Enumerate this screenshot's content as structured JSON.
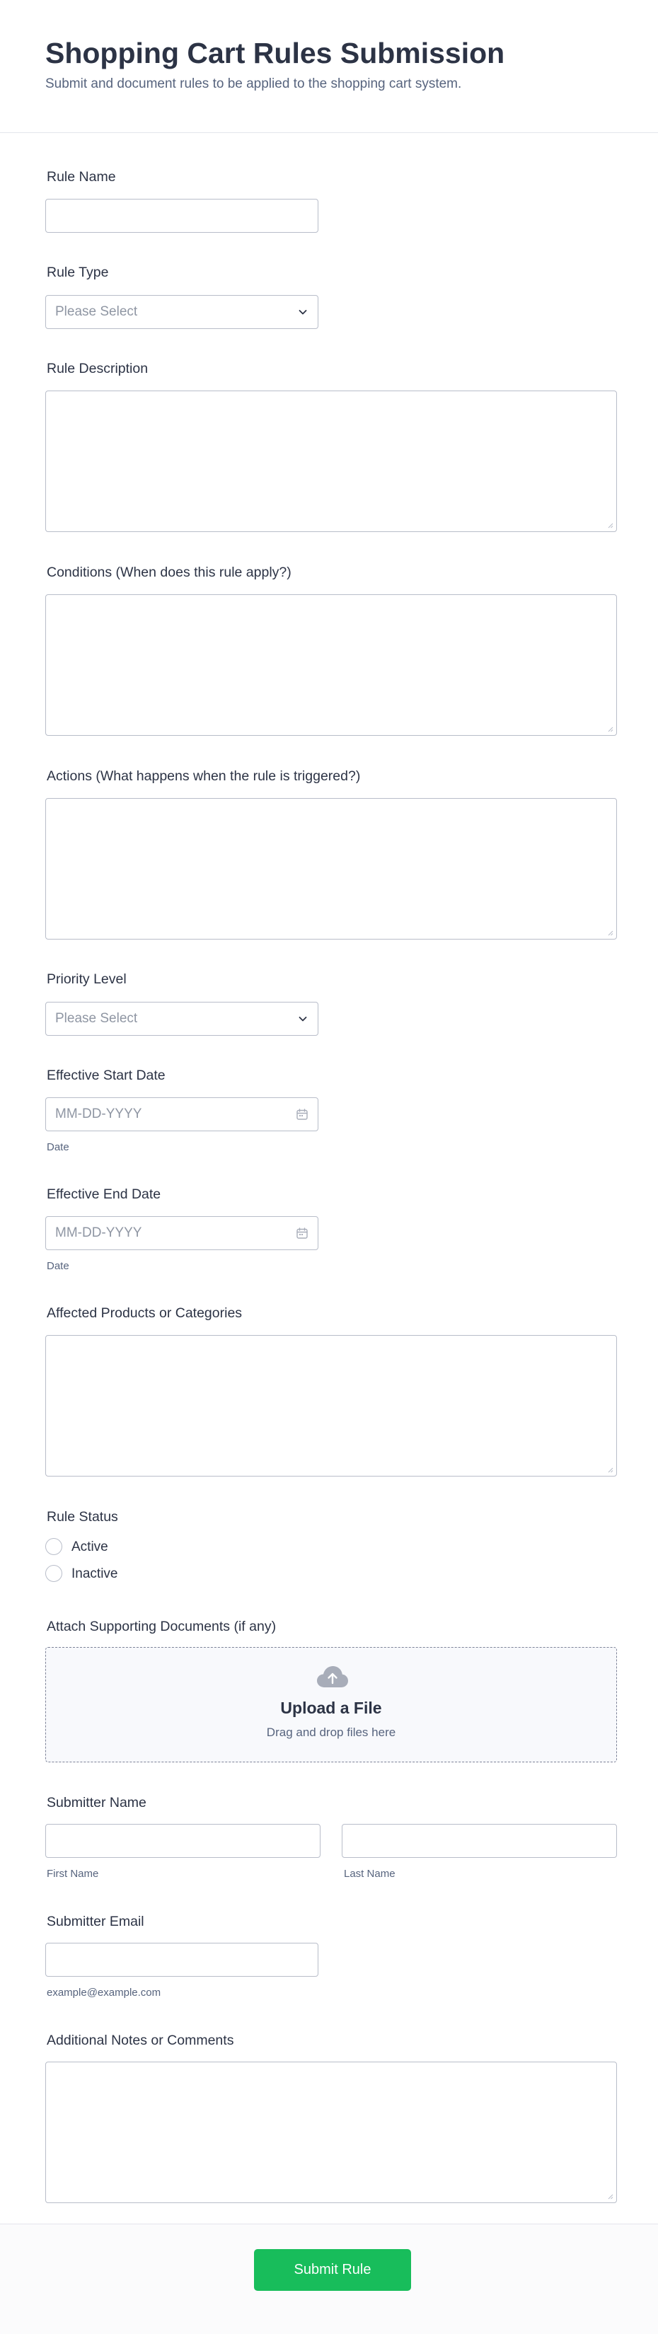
{
  "header": {
    "title": "Shopping Cart Rules Submission",
    "subtitle": "Submit and document rules to be applied to the shopping cart system."
  },
  "fields": {
    "rule_name": {
      "label": "Rule Name",
      "value": ""
    },
    "rule_type": {
      "label": "Rule Type",
      "placeholder": "Please Select"
    },
    "rule_description": {
      "label": "Rule Description",
      "value": ""
    },
    "conditions": {
      "label": "Conditions (When does this rule apply?)",
      "value": ""
    },
    "actions": {
      "label": "Actions (What happens when the rule is triggered?)",
      "value": ""
    },
    "priority_level": {
      "label": "Priority Level",
      "placeholder": "Please Select"
    },
    "start_date": {
      "label": "Effective Start Date",
      "placeholder": "MM-DD-YYYY",
      "sublabel": "Date"
    },
    "end_date": {
      "label": "Effective End Date",
      "placeholder": "MM-DD-YYYY",
      "sublabel": "Date"
    },
    "affected_products": {
      "label": "Affected Products or Categories",
      "value": ""
    },
    "rule_status": {
      "label": "Rule Status",
      "options": [
        "Active",
        "Inactive"
      ]
    },
    "attachments": {
      "label": "Attach Supporting Documents (if any)",
      "upload_title": "Upload a File",
      "upload_hint": "Drag and drop files here"
    },
    "submitter_name": {
      "label": "Submitter Name",
      "first_sublabel": "First Name",
      "last_sublabel": "Last Name"
    },
    "submitter_email": {
      "label": "Submitter Email",
      "sublabel": "example@example.com"
    },
    "notes": {
      "label": "Additional Notes or Comments",
      "value": ""
    }
  },
  "footer": {
    "submit_label": "Submit Rule"
  },
  "colors": {
    "accent": "#18bd5b",
    "text": "#2c3345",
    "muted": "#57647e",
    "border": "#b8bdc9",
    "icon": "#a8adb9"
  },
  "icons": {
    "select": "chevron-down-icon",
    "date": "calendar-icon",
    "upload": "cloud-upload-icon",
    "textarea": "resize-handle-icon"
  }
}
